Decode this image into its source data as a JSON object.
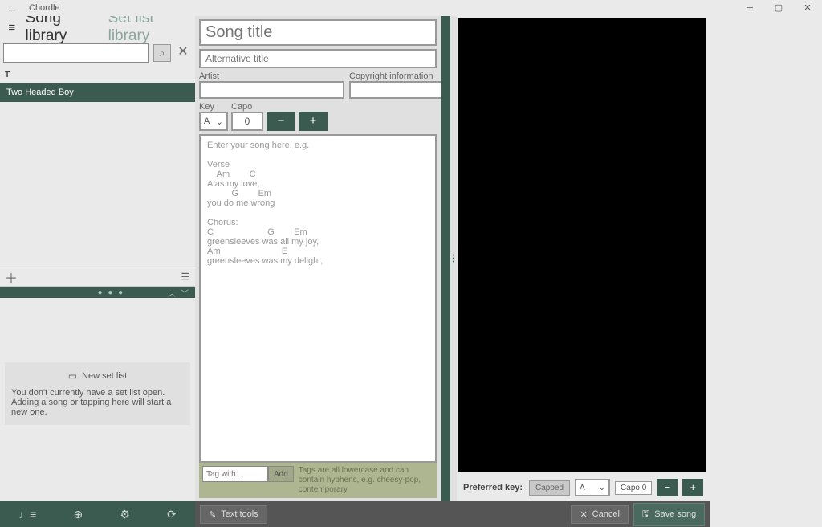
{
  "app": {
    "title": "Chordle"
  },
  "tabs": {
    "library": "Song library",
    "setlist": "Set list library"
  },
  "search": {
    "placeholder": ""
  },
  "song_list": {
    "letter": "T",
    "items": [
      {
        "title": "Two Headed Boy"
      }
    ]
  },
  "setlist_panel": {
    "new": "New set list",
    "hint": "You don't currently have a set list open. Adding a song or tapping here will start a new one."
  },
  "editor": {
    "title_placeholder": "Song title",
    "alt_placeholder": "Alternative title",
    "artist_label": "Artist",
    "copyright_label": "Copyright information",
    "key_label": "Key",
    "capo_label": "Capo",
    "key_value": "A",
    "capo_value": "0",
    "body_placeholder": "Enter your song here, e.g.\n\nVerse\n    Am        C\nAlas my love,\n          G        Em\nyou do me wrong\n\nChorus:\nC                      G        Em\ngreensleeves was all my joy,\nAm                         E\ngreensleeves was my delight,",
    "minus": "−",
    "plus": "+"
  },
  "tags": {
    "placeholder": "Tag with...",
    "add": "Add",
    "hint": "Tags are all lowercase and can contain hyphens, e.g. cheesy-pop, contemporary"
  },
  "footer": {
    "text_tools": "Text tools",
    "cancel": "Cancel",
    "save": "Save song"
  },
  "preview": {
    "pref_key_label": "Preferred key:",
    "capoed": "Capoed",
    "key_value": "A",
    "capo_chip": "Capo 0",
    "minus": "−",
    "plus": "+"
  }
}
